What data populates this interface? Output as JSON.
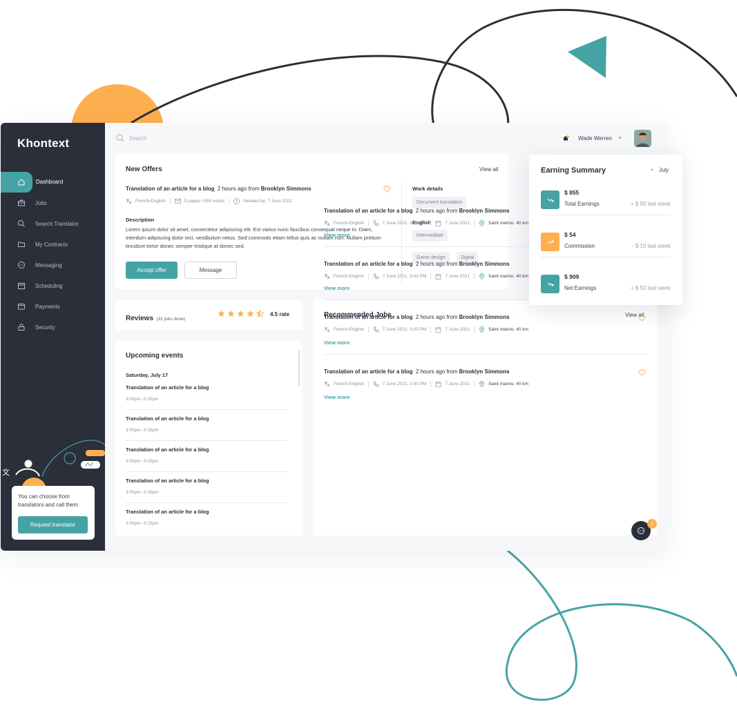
{
  "app": {
    "name": "Khontext"
  },
  "sidebar": {
    "items": [
      {
        "label": "Dashboard",
        "icon": "home-icon",
        "active": true
      },
      {
        "label": "Jobs",
        "icon": "briefcase-icon"
      },
      {
        "label": "Search Translator",
        "icon": "search-icon"
      },
      {
        "label": "My Contracts",
        "icon": "folder-icon"
      },
      {
        "label": "Messaging",
        "icon": "chat-icon"
      },
      {
        "label": "Scheduling",
        "icon": "calendar-icon"
      },
      {
        "label": "Payments",
        "icon": "wallet-icon"
      },
      {
        "label": "Security",
        "icon": "lock-icon"
      }
    ],
    "promo": {
      "text": "You can choose from translators and call them",
      "button": "Request translator"
    }
  },
  "topbar": {
    "search_placeholder": "Search",
    "user_name": "Wade Werren"
  },
  "new_offers": {
    "title": "New Offers",
    "view_all": "View all",
    "job_title": "Translation of an article for a blog",
    "posted": "2 hours ago from",
    "author": "Brooklyn Simmons",
    "language": "French-English",
    "pages": "5 pages / 950 words",
    "needed": "Needed by: 7 June 2021",
    "description_label": "Description",
    "description": "Lorem ipsum dolor sit amet, consectetur adipiscing elit. Est varius nunc faucibus consequat neque in. Diam, interdum adipiscing dolor orci, vestibulum netus. Sed commodo etiam tellus quis ac nullam non. Nullam pretium tincidunt tortor donec semper tristique at donec sed.",
    "accept_button": "Accept offer",
    "message_button": "Message",
    "work_details_label": "Work details",
    "work_tag": "Document translation",
    "english_label": "English",
    "english_tag": "Intermediate",
    "tags": [
      "Game design",
      "Digital"
    ]
  },
  "reviews": {
    "title": "Reviews",
    "jobs_done": "(32 jobs done)",
    "rating": 4.5,
    "rate_label": "4.5 rate"
  },
  "upcoming_events": {
    "title": "Upcoming events",
    "date": "Saturday, July 17",
    "events": [
      {
        "title": "Translation of an article for a blog",
        "time": "3:00pm -3:15pm"
      },
      {
        "title": "Translation of an article for a blog",
        "time": "3:00pm -3:15pm"
      },
      {
        "title": "Translation of an article for a blog",
        "time": "3:00pm -3:15pm"
      },
      {
        "title": "Translation of an article for a blog",
        "time": "3:00pm -3:15pm"
      },
      {
        "title": "Translation of an article for a blog",
        "time": "3:00pm -3:15pm"
      }
    ]
  },
  "recommended_jobs": {
    "title": "Recommended Jobs",
    "view_all": "View all",
    "jobs": [
      {
        "title": "Translation of an article for a blog",
        "posted": "2 hours ago from",
        "author": "Brooklyn Simmons",
        "language": "French-English",
        "call": "7 June 2021, 3:00 PM",
        "date": "7 June 2021",
        "location": "Saint marino. 40 km",
        "more": "View more"
      },
      {
        "title": "Translation of an article for a blog",
        "posted": "2 hours ago from",
        "author": "Brooklyn Simmons",
        "language": "French-English",
        "call": "7 June 2021, 3:00 PM",
        "date": "7 June 2021",
        "location": "Saint marino. 40 km",
        "more": "View more"
      },
      {
        "title": "Translation of an article for a blog",
        "posted": "2 hours ago from",
        "author": "Brooklyn Simmons",
        "language": "French-English",
        "call": "7 June 2021, 3:00 PM",
        "date": "7 June 2021",
        "location": "Saint marino. 40 km",
        "more": "View more"
      },
      {
        "title": "Translation of an article for a blog",
        "posted": "2 hours ago from",
        "author": "Brooklyn Simmons",
        "language": "French-English",
        "call": "7 June 2021, 3:00 PM",
        "date": "7 June 2021",
        "location": "Saint marino. 40 km",
        "more": "View more"
      }
    ],
    "chat_badge": "1"
  },
  "earning_summary": {
    "title": "Earning Summary",
    "month": "July",
    "rows": [
      {
        "amount": "$ 855",
        "label": "Total Earnings",
        "change": "+ $ 50 last week",
        "color": "#46a3a4",
        "trend": "down"
      },
      {
        "amount": "$ 54",
        "label": "Commission",
        "change": "- $ 10 last week",
        "color": "#fdaf4f",
        "trend": "up"
      },
      {
        "amount": "$ 909",
        "label": "Net Earnings",
        "change": "+ $ 50 last week",
        "color": "#46a3a4",
        "trend": "down"
      }
    ]
  },
  "colors": {
    "accent": "#46a3a4",
    "orange": "#fdaf4f",
    "sidebar": "#2a2f3a"
  }
}
